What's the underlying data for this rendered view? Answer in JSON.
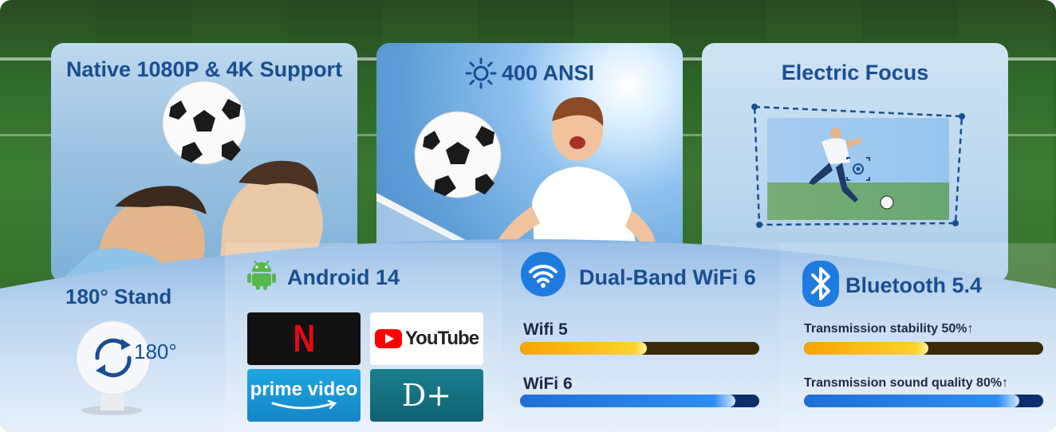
{
  "cards": {
    "resolution": {
      "title": "Native 1080P & 4K Support"
    },
    "brightness": {
      "title": "400 ANSI"
    },
    "focus": {
      "title": "Electric Focus"
    }
  },
  "features": {
    "stand": {
      "title": "180° Stand",
      "angle_label": "180°"
    },
    "android": {
      "title": "Android 14",
      "apps": [
        {
          "name": "netflix",
          "label": "N"
        },
        {
          "name": "youtube",
          "label": "YouTube"
        },
        {
          "name": "prime-video",
          "label": "prime video"
        },
        {
          "name": "disney-plus",
          "label": "D+"
        }
      ]
    },
    "wifi": {
      "title": "Dual-Band WiFi 6",
      "bars": [
        {
          "label": "Wifi 5",
          "level": 0.53
        },
        {
          "label": "WiFi 6",
          "level": 0.9
        }
      ]
    },
    "bluetooth": {
      "title": "Bluetooth 5.4",
      "bars": [
        {
          "label": "Transmission stability  50%↑",
          "level": 0.52
        },
        {
          "label": "Transmission sound quality 80%↑",
          "level": 0.9
        }
      ]
    }
  },
  "colors": {
    "title_blue": "#1a4e93",
    "gold": "#ffc51a",
    "blue": "#2e8df0",
    "netflix_red": "#e50914",
    "youtube_red": "#ff0000"
  }
}
